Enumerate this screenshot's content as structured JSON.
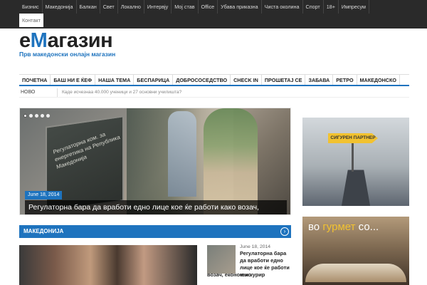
{
  "top_nav": {
    "items": [
      "Бизнис",
      "Македонија",
      "Балкан",
      "Свет",
      "Локално",
      "Интервју",
      "Мој став",
      "Office",
      "Убава приказна",
      "Чиста околина",
      "Спорт",
      "18+",
      "Импресум"
    ],
    "second_row": [
      "Контакт"
    ]
  },
  "logo": {
    "title_prefix": "е",
    "title_accent": "М",
    "title_rest": "агазин",
    "subtitle": "Прв македонски онлајн магазин"
  },
  "main_nav": {
    "items": [
      "ПОЧЕТНА",
      "БАШ НИ Е ЌЕФ",
      "НАША ТЕМА",
      "БЕСПАРИЦА",
      "ДОБРОСОСЕДСТВО",
      "CHECK IN",
      "ПРОШЕТАЈ СЕ",
      "ЗАБАВА",
      "РЕТРО",
      "МАКЕДОНСКО"
    ]
  },
  "ticker": {
    "label": "НОВО",
    "text": "Каде исчезнаа 40.000 ученици и 27 основни училишта?"
  },
  "slider": {
    "date": "June 18, 2014",
    "caption": "Регулаторна бара да вработи едно лице кое ќе работи како возач, економ и курир",
    "sign_text": "Регулаторна ком. за енергетика на Република Македонија",
    "dots": 5,
    "active_dot": 0
  },
  "section": {
    "title": "МАКЕДОНИЈА",
    "arrow_icon": "arrow-right-circle-icon"
  },
  "side_article": {
    "date": "June 18, 2014",
    "title_part1": "Регулаторна бара да вработи едно лице кое ќе работи како",
    "title_part2": "возач, економ и курир"
  },
  "ads": {
    "ad1_sign": "СИГУРЕН ПАРТНЕР",
    "ad2_prefix": "во",
    "ad2_highlight": "гурмет",
    "ad2_suffix": "со..."
  },
  "colors": {
    "accent": "#1e73be",
    "topbar": "#2a2a2a",
    "sign": "#f2c230"
  }
}
